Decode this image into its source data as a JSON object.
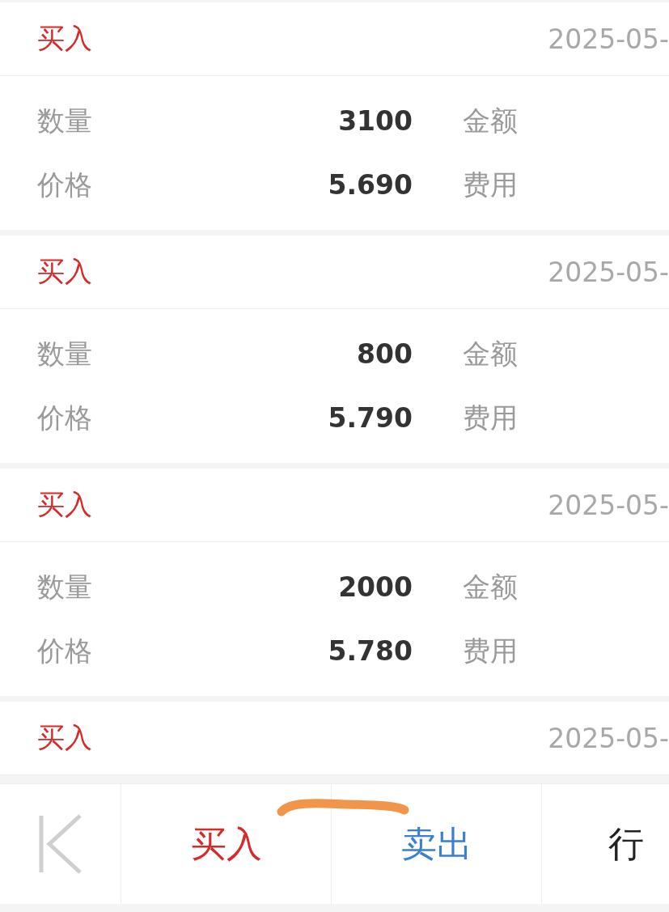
{
  "records": [
    {
      "kind": "buy",
      "type": "买入",
      "date": "2025-05-",
      "rows": [
        {
          "label": "数量",
          "value": "3100",
          "label_2": "金额"
        },
        {
          "label": "价格",
          "value": "5.690",
          "label_2": "费用"
        }
      ]
    },
    {
      "kind": "buy",
      "type": "买入",
      "date": "2025-05-",
      "rows": [
        {
          "label": "数量",
          "value": "800",
          "label_2": "金额"
        },
        {
          "label": "价格",
          "value": "5.790",
          "label_2": "费用"
        }
      ]
    },
    {
      "kind": "buy",
      "type": "买入",
      "date": "2025-05-",
      "rows": [
        {
          "label": "数量",
          "value": "2000",
          "label_2": "金额"
        },
        {
          "label": "价格",
          "value": "5.780",
          "label_2": "费用"
        }
      ]
    },
    {
      "kind": "buy",
      "type": "买入",
      "date": "2025-05-"
    }
  ],
  "toolbar": {
    "buttons": [
      {
        "kind": "first"
      },
      {
        "kind": "buy",
        "label": "买入"
      },
      {
        "kind": "sell",
        "label": "卖出"
      },
      {
        "kind": "plain",
        "label": "行"
      }
    ]
  }
}
